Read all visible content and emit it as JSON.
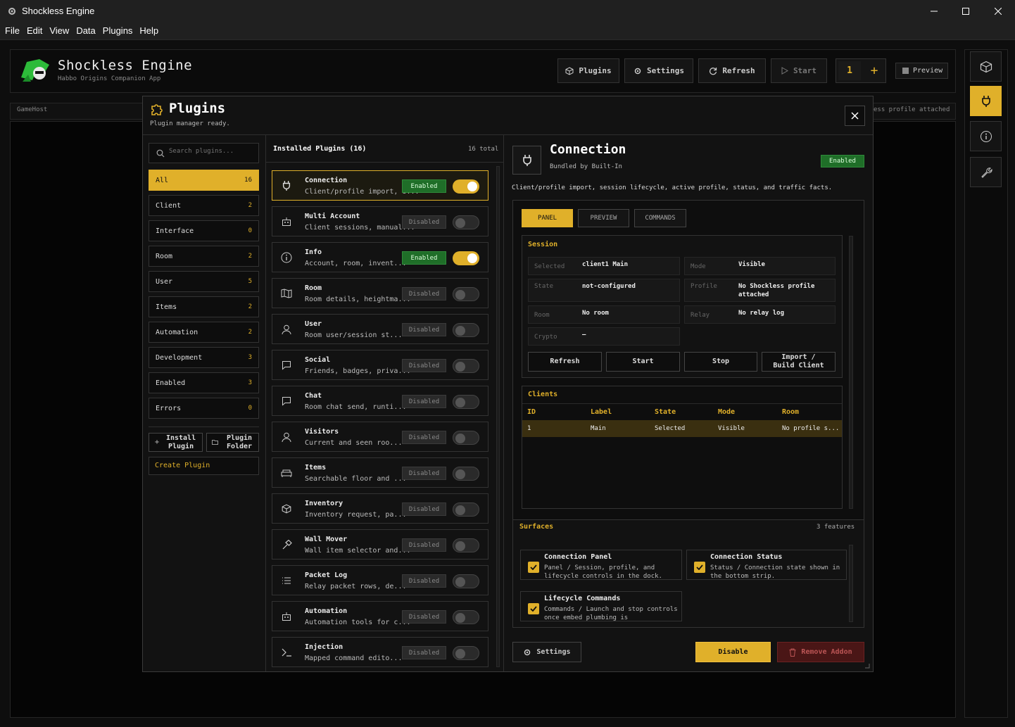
{
  "window": {
    "title": "Shockless Engine"
  },
  "menu": [
    "File",
    "Edit",
    "View",
    "Data",
    "Plugins",
    "Help"
  ],
  "header": {
    "app_name": "Shockless Engine",
    "subtitle": "Habbo Origins Companion App",
    "buttons": {
      "plugins": "Plugins",
      "settings": "Settings",
      "refresh": "Refresh",
      "start": "Start"
    },
    "counter": "1",
    "plus": "+",
    "preview": "Preview"
  },
  "strip": {
    "left": "GameHost",
    "right": "ess profile attached"
  },
  "modal": {
    "title": "Plugins",
    "status": "Plugin manager ready.",
    "search_placeholder": "Search plugins...",
    "categories": [
      {
        "label": "All",
        "count": "16"
      },
      {
        "label": "Client",
        "count": "2"
      },
      {
        "label": "Interface",
        "count": "0"
      },
      {
        "label": "Room",
        "count": "2"
      },
      {
        "label": "User",
        "count": "5"
      },
      {
        "label": "Items",
        "count": "2"
      },
      {
        "label": "Automation",
        "count": "2"
      },
      {
        "label": "Development",
        "count": "3"
      },
      {
        "label": "Enabled",
        "count": "3"
      },
      {
        "label": "Errors",
        "count": "0"
      }
    ],
    "install_plugin": "Install Plugin",
    "plugin_folder": "Plugin Folder",
    "create_plugin": "Create Plugin",
    "list_title": "Installed Plugins (16)",
    "list_total": "16 total",
    "plugins": [
      {
        "name": "Connection",
        "desc": "Client/profile import, s...",
        "state": "Enabled",
        "icon": "plug-icon"
      },
      {
        "name": "Multi Account",
        "desc": "Client sessions, manual...",
        "state": "Disabled",
        "icon": "robot-icon"
      },
      {
        "name": "Info",
        "desc": "Account, room, invent...",
        "state": "Enabled",
        "icon": "info-icon"
      },
      {
        "name": "Room",
        "desc": "Room details, heightma...",
        "state": "Disabled",
        "icon": "map-icon"
      },
      {
        "name": "User",
        "desc": "Room user/session st...",
        "state": "Disabled",
        "icon": "user-icon"
      },
      {
        "name": "Social",
        "desc": "Friends, badges, priva...",
        "state": "Disabled",
        "icon": "chat-icon"
      },
      {
        "name": "Chat",
        "desc": "Room chat send, runti...",
        "state": "Disabled",
        "icon": "chat-icon"
      },
      {
        "name": "Visitors",
        "desc": "Current and seen roo...",
        "state": "Disabled",
        "icon": "user-icon"
      },
      {
        "name": "Items",
        "desc": "Searchable floor and ...",
        "state": "Disabled",
        "icon": "sofa-icon"
      },
      {
        "name": "Inventory",
        "desc": "Inventory request, pa...",
        "state": "Disabled",
        "icon": "box-icon"
      },
      {
        "name": "Wall Mover",
        "desc": "Wall item selector and...",
        "state": "Disabled",
        "icon": "hammer-icon"
      },
      {
        "name": "Packet Log",
        "desc": "Relay packet rows, de...",
        "state": "Disabled",
        "icon": "list-icon"
      },
      {
        "name": "Automation",
        "desc": "Automation tools for c...",
        "state": "Disabled",
        "icon": "robot-icon"
      },
      {
        "name": "Injection",
        "desc": "Mapped command edito...",
        "state": "Disabled",
        "icon": "terminal-icon"
      }
    ],
    "detail": {
      "name": "Connection",
      "bundled": "Bundled by Built-In",
      "badge": "Enabled",
      "description": "Client/profile import, session lifecycle, active profile, status, and traffic facts.",
      "tabs": [
        "PANEL",
        "PREVIEW",
        "COMMANDS"
      ],
      "session_title": "Session",
      "fields": {
        "selected": {
          "k": "Selected",
          "v": "client1 Main"
        },
        "mode": {
          "k": "Mode",
          "v": "Visible"
        },
        "state": {
          "k": "State",
          "v": "not-configured"
        },
        "profile": {
          "k": "Profile",
          "v": "No Shockless profile attached"
        },
        "room": {
          "k": "Room",
          "v": "No room"
        },
        "relay": {
          "k": "Relay",
          "v": "No relay log"
        },
        "crypto": {
          "k": "Crypto",
          "v": "—"
        }
      },
      "actions": {
        "refresh": "Refresh",
        "start": "Start",
        "stop": "Stop",
        "import": "Import / Build Client"
      },
      "clients_title": "Clients",
      "clients_headers": [
        "ID",
        "Label",
        "State",
        "Mode",
        "Room"
      ],
      "clients_rows": [
        [
          "1",
          "Main",
          "Selected",
          "Visible",
          "No profile s..."
        ]
      ],
      "surfaces_title": "Surfaces",
      "surfaces_count": "3 features",
      "surfaces": [
        {
          "title": "Connection Panel",
          "desc": "Panel / Session, profile, and lifecycle controls in the dock."
        },
        {
          "title": "Connection Status",
          "desc": "Status / Connection state shown in the bottom strip."
        },
        {
          "title": "Lifecycle Commands",
          "desc": "Commands / Launch and stop controls once embed plumbing is"
        }
      ],
      "footer": {
        "settings": "Settings",
        "disable": "Disable",
        "remove": "Remove Addon"
      }
    }
  },
  "colors": {
    "accent": "#e0b02a",
    "enabled": "#1f6e28",
    "danger": "#4a1616"
  }
}
